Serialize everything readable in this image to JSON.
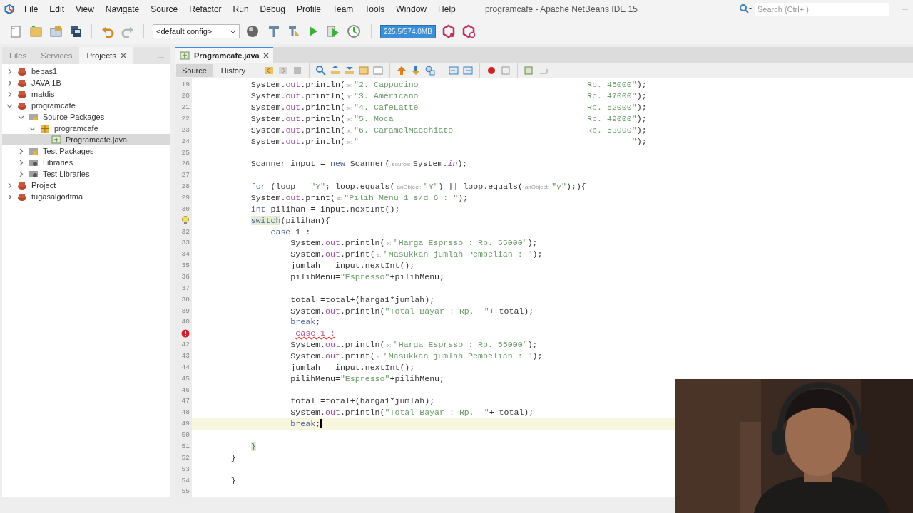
{
  "app_title": "programcafe - Apache NetBeans IDE 15",
  "menu": [
    "File",
    "Edit",
    "View",
    "Navigate",
    "Source",
    "Refactor",
    "Run",
    "Debug",
    "Profile",
    "Team",
    "Tools",
    "Window",
    "Help"
  ],
  "search": {
    "placeholder": "Search (Ctrl+I)"
  },
  "toolbar": {
    "config": "<default config>",
    "memory": "225.5/574.0MB"
  },
  "side_tabs": [
    {
      "label": "Files",
      "selected": false,
      "closable": false
    },
    {
      "label": "Services",
      "selected": false,
      "closable": false
    },
    {
      "label": "Projects",
      "selected": true,
      "closable": true
    }
  ],
  "tree": [
    {
      "label": "bebas1",
      "kind": "project",
      "expanded": false,
      "selected": false
    },
    {
      "label": "JAVA 1B",
      "kind": "project",
      "expanded": false,
      "selected": false
    },
    {
      "label": "matdis",
      "kind": "project",
      "expanded": false,
      "selected": false
    },
    {
      "label": "programcafe",
      "kind": "project",
      "expanded": true,
      "selected": false,
      "children": [
        {
          "label": "Source Packages",
          "kind": "folder",
          "expanded": true,
          "selected": false,
          "children": [
            {
              "label": "programcafe",
              "kind": "package",
              "expanded": true,
              "selected": false,
              "children": [
                {
                  "label": "Programcafe.java",
                  "kind": "file",
                  "selected": true
                }
              ]
            }
          ]
        },
        {
          "label": "Test Packages",
          "kind": "folder",
          "expanded": false,
          "selected": false
        },
        {
          "label": "Libraries",
          "kind": "library",
          "expanded": false,
          "selected": false
        },
        {
          "label": "Test Libraries",
          "kind": "library",
          "expanded": false,
          "selected": false
        }
      ]
    },
    {
      "label": "Project",
      "kind": "project",
      "expanded": false,
      "selected": false
    },
    {
      "label": "tugasalgoritma",
      "kind": "project",
      "expanded": false,
      "selected": false
    }
  ],
  "editor_tab": {
    "label": "Programcafe.java"
  },
  "view_modes": [
    {
      "label": "Source",
      "selected": true
    },
    {
      "label": "History",
      "selected": false
    }
  ],
  "code_lines": [
    {
      "number": "19",
      "tokens": [
        {
          "kind": "plain",
          "t": "        System."
        },
        {
          "kind": "field",
          "t": "out"
        },
        {
          "kind": "plain",
          "t": ".println("
        },
        {
          "kind": "hint",
          "t": "x:"
        },
        {
          "kind": "string",
          "t": "\"2. Cappucino                                  Rp. 45000\""
        },
        {
          "kind": "plain",
          "t": ");"
        }
      ]
    },
    {
      "number": "20",
      "tokens": [
        {
          "kind": "plain",
          "t": "        System."
        },
        {
          "kind": "field",
          "t": "out"
        },
        {
          "kind": "plain",
          "t": ".println("
        },
        {
          "kind": "hint",
          "t": "x:"
        },
        {
          "kind": "string",
          "t": "\"3. Americano                                  Rp. 47000\""
        },
        {
          "kind": "plain",
          "t": ");"
        }
      ]
    },
    {
      "number": "21",
      "tokens": [
        {
          "kind": "plain",
          "t": "        System."
        },
        {
          "kind": "field",
          "t": "out"
        },
        {
          "kind": "plain",
          "t": ".println("
        },
        {
          "kind": "hint",
          "t": "x:"
        },
        {
          "kind": "string",
          "t": "\"4. CafeLatte                                  Rp. 52000\""
        },
        {
          "kind": "plain",
          "t": ");"
        }
      ]
    },
    {
      "number": "22",
      "tokens": [
        {
          "kind": "plain",
          "t": "        System."
        },
        {
          "kind": "field",
          "t": "out"
        },
        {
          "kind": "plain",
          "t": ".println("
        },
        {
          "kind": "hint",
          "t": "x:"
        },
        {
          "kind": "string",
          "t": "\"5. Moca                                       Rp. 49000\""
        },
        {
          "kind": "plain",
          "t": ");"
        }
      ]
    },
    {
      "number": "23",
      "tokens": [
        {
          "kind": "plain",
          "t": "        System."
        },
        {
          "kind": "field",
          "t": "out"
        },
        {
          "kind": "plain",
          "t": ".println("
        },
        {
          "kind": "hint",
          "t": "x:"
        },
        {
          "kind": "string",
          "t": "\"6. CaramelMacchiato                           Rp. 53000\""
        },
        {
          "kind": "plain",
          "t": ");"
        }
      ]
    },
    {
      "number": "24",
      "tokens": [
        {
          "kind": "plain",
          "t": "        System."
        },
        {
          "kind": "field",
          "t": "out"
        },
        {
          "kind": "plain",
          "t": ".println("
        },
        {
          "kind": "hint",
          "t": "x:"
        },
        {
          "kind": "string",
          "t": "\"=======================================================\""
        },
        {
          "kind": "plain",
          "t": ");"
        }
      ]
    },
    {
      "number": "25"
    },
    {
      "number": "26",
      "tokens": [
        {
          "kind": "plain",
          "t": "        Scanner input = "
        },
        {
          "kind": "keyword",
          "t": "new"
        },
        {
          "kind": "plain",
          "t": " Scanner("
        },
        {
          "kind": "hint",
          "t": "source:"
        },
        {
          "kind": "plain",
          "t": "System."
        },
        {
          "kind": "italic",
          "t": "in"
        },
        {
          "kind": "plain",
          "t": ");"
        }
      ]
    },
    {
      "number": "27"
    },
    {
      "number": "28",
      "tokens": [
        {
          "kind": "keyword",
          "t": "        for"
        },
        {
          "kind": "plain",
          "t": " (loop = "
        },
        {
          "kind": "string",
          "t": "\"Y\""
        },
        {
          "kind": "plain",
          "t": "; loop.equals("
        },
        {
          "kind": "hint",
          "t": "anObject:"
        },
        {
          "kind": "string",
          "t": "\"Y\""
        },
        {
          "kind": "plain",
          "t": ") || loop.equals("
        },
        {
          "kind": "hint",
          "t": "anObject:"
        },
        {
          "kind": "string",
          "t": "\"y\""
        },
        {
          "kind": "plain",
          "t": ");){"
        }
      ]
    },
    {
      "number": "29",
      "tokens": [
        {
          "kind": "plain",
          "t": "        System."
        },
        {
          "kind": "field",
          "t": "out"
        },
        {
          "kind": "plain",
          "t": ".print("
        },
        {
          "kind": "hint",
          "t": "s:"
        },
        {
          "kind": "string",
          "t": "\"Pilih Menu 1 s/d 6 : \""
        },
        {
          "kind": "plain",
          "t": ");"
        }
      ]
    },
    {
      "number": "30",
      "tokens": [
        {
          "kind": "keyword",
          "t": "        int"
        },
        {
          "kind": "plain",
          "t": " pilihan = input.nextInt();"
        }
      ]
    },
    {
      "kind": "hint",
      "tokens": [
        {
          "kind": "match",
          "t": "        switch"
        },
        {
          "kind": "plain",
          "t": "(pilihan){"
        }
      ]
    },
    {
      "number": "32",
      "tokens": [
        {
          "kind": "keyword",
          "t": "            case"
        },
        {
          "kind": "plain",
          "t": " 1 :"
        }
      ]
    },
    {
      "number": "33",
      "tokens": [
        {
          "kind": "plain",
          "t": "                System."
        },
        {
          "kind": "field",
          "t": "out"
        },
        {
          "kind": "plain",
          "t": ".println("
        },
        {
          "kind": "hint",
          "t": "x:"
        },
        {
          "kind": "string",
          "t": "\"Harga Esprsso : Rp. 55000\""
        },
        {
          "kind": "plain",
          "t": ");"
        }
      ]
    },
    {
      "number": "34",
      "tokens": [
        {
          "kind": "plain",
          "t": "                System."
        },
        {
          "kind": "field",
          "t": "out"
        },
        {
          "kind": "plain",
          "t": ".print("
        },
        {
          "kind": "hint",
          "t": "s:"
        },
        {
          "kind": "string",
          "t": "\"Masukkan jumlah Pembelian : \""
        },
        {
          "kind": "plain",
          "t": ");"
        }
      ]
    },
    {
      "number": "35",
      "tokens": [
        {
          "kind": "plain",
          "t": "                jumlah = input.nextInt();"
        }
      ]
    },
    {
      "number": "36",
      "tokens": [
        {
          "kind": "plain",
          "t": "                pilihMenu="
        },
        {
          "kind": "string",
          "t": "\"Espresso\""
        },
        {
          "kind": "plain",
          "t": "+pilihMenu;"
        }
      ]
    },
    {
      "number": "37"
    },
    {
      "number": "38",
      "tokens": [
        {
          "kind": "plain",
          "t": "                total =total+(harga1*jumlah);"
        }
      ]
    },
    {
      "number": "39",
      "tokens": [
        {
          "kind": "plain",
          "t": "                System."
        },
        {
          "kind": "field",
          "t": "out"
        },
        {
          "kind": "plain",
          "t": ".println("
        },
        {
          "kind": "string",
          "t": "\"Total Bayar : Rp.  \""
        },
        {
          "kind": "plain",
          "t": "+ total);"
        }
      ]
    },
    {
      "number": "40",
      "tokens": [
        {
          "kind": "keyword",
          "t": "                break"
        },
        {
          "kind": "plain",
          "t": ";"
        }
      ]
    },
    {
      "kind": "error",
      "tokens": [
        {
          "kind": "error",
          "t": "                 case 1 :"
        }
      ]
    },
    {
      "number": "42",
      "tokens": [
        {
          "kind": "plain",
          "t": "                System."
        },
        {
          "kind": "field",
          "t": "out"
        },
        {
          "kind": "plain",
          "t": ".println("
        },
        {
          "kind": "hint",
          "t": "x:"
        },
        {
          "kind": "string",
          "t": "\"Harga Esprsso : Rp. 55000\""
        },
        {
          "kind": "plain",
          "t": ");"
        }
      ]
    },
    {
      "number": "43",
      "tokens": [
        {
          "kind": "plain",
          "t": "                System."
        },
        {
          "kind": "field",
          "t": "out"
        },
        {
          "kind": "plain",
          "t": ".print("
        },
        {
          "kind": "hint",
          "t": "s:"
        },
        {
          "kind": "string",
          "t": "\"Masukkan jumlah Pembelian : \""
        },
        {
          "kind": "plain",
          "t": ");"
        }
      ]
    },
    {
      "number": "44",
      "tokens": [
        {
          "kind": "plain",
          "t": "                jumlah = input.nextInt();"
        }
      ]
    },
    {
      "number": "45",
      "tokens": [
        {
          "kind": "plain",
          "t": "                pilihMenu="
        },
        {
          "kind": "string",
          "t": "\"Espresso\""
        },
        {
          "kind": "plain",
          "t": "+pilihMenu;"
        }
      ]
    },
    {
      "number": "46"
    },
    {
      "number": "47",
      "tokens": [
        {
          "kind": "plain",
          "t": "                total =total+(harga1*jumlah);"
        }
      ]
    },
    {
      "number": "48",
      "tokens": [
        {
          "kind": "plain",
          "t": "                System."
        },
        {
          "kind": "field",
          "t": "out"
        },
        {
          "kind": "plain",
          "t": ".println("
        },
        {
          "kind": "string",
          "t": "\"Total Bayar : Rp.  \""
        },
        {
          "kind": "plain",
          "t": "+ total);"
        }
      ]
    },
    {
      "number": "49",
      "current": true,
      "tokens": [
        {
          "kind": "keyword",
          "t": "                break"
        },
        {
          "kind": "plain",
          "t": ";"
        }
      ]
    },
    {
      "number": "50"
    },
    {
      "number": "51",
      "tokens": [
        {
          "kind": "match",
          "t": "        }"
        }
      ]
    },
    {
      "number": "52",
      "tokens": [
        {
          "kind": "plain",
          "t": "    }"
        }
      ]
    },
    {
      "number": "53"
    },
    {
      "number": "54",
      "tokens": [
        {
          "kind": "plain",
          "t": "    }"
        }
      ]
    },
    {
      "number": "55"
    }
  ]
}
